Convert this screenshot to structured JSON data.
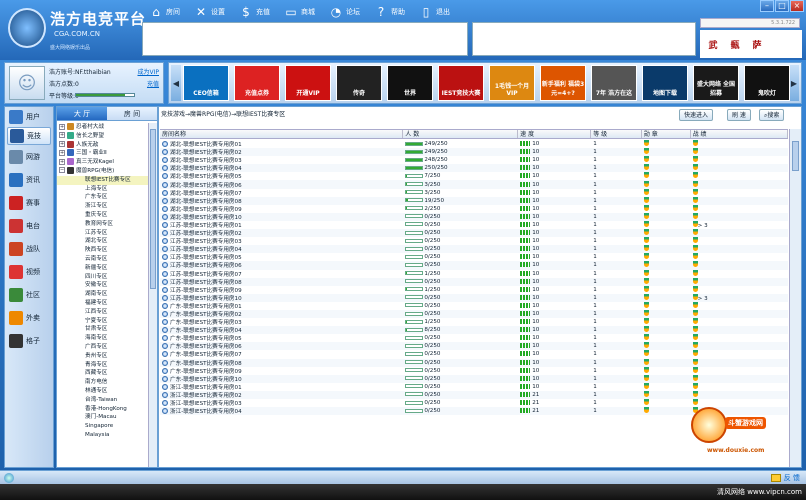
{
  "app": {
    "logo_title": "浩方电竞平台",
    "logo_url": "CGA.COM.CN",
    "logo_slogan": "盛大网络娱乐出品",
    "version": "5.3.1.722"
  },
  "topnav": [
    {
      "icon": "house-icon",
      "label": "房间"
    },
    {
      "icon": "wrench-icon",
      "label": "设置"
    },
    {
      "icon": "dollar-icon",
      "label": "充值"
    },
    {
      "icon": "folder-icon",
      "label": "商城"
    },
    {
      "icon": "chat-icon",
      "label": "论坛"
    },
    {
      "icon": "question-icon",
      "label": "帮助"
    },
    {
      "icon": "exit-icon",
      "label": "退出"
    }
  ],
  "side_icons": [
    "武",
    "甀",
    "萨"
  ],
  "user": {
    "account_label": "浩方账号:",
    "account": "NF.tthaibian",
    "points_label": "浩方点数:",
    "points": "0",
    "level_label": "平台等级:",
    "level": "0",
    "vip_link": "成为VIP",
    "recharge_link": "充值",
    "level_fill": 0.85
  },
  "promos": [
    "CEO信箱",
    "充值点券",
    "开通VIP",
    "传奇",
    "世界",
    "IEST竞技大赛",
    "1毛钱一个月VIP",
    "新手福利 福袋3元=4+?",
    "7年 浩方在这",
    "地图下载",
    "盛大网络 全国招募",
    "鬼吹灯"
  ],
  "leftnav": [
    "用户",
    "竞技",
    "网游",
    "资讯",
    "赛事",
    "电台",
    "战队",
    "视频",
    "社区",
    "外卖",
    "格子"
  ],
  "tree": {
    "tabs": [
      "大 厅",
      "房 间"
    ],
    "games": [
      {
        "label": "忍者村大战",
        "exp": "+"
      },
      {
        "label": "信长之野望",
        "exp": "+"
      },
      {
        "label": "人族无敌",
        "exp": "+"
      },
      {
        "label": "三国・霸业Ⅱ",
        "exp": "+"
      },
      {
        "label": "真三无双Kagel",
        "exp": "+"
      },
      {
        "label": "魔兽RPG(电信)",
        "exp": "−"
      }
    ],
    "leaves": [
      "联想IEST比赛专区",
      "上海专区",
      "广东专区",
      "浙江专区",
      "重庆专区",
      "教育网专区",
      "江苏专区",
      "湖北专区",
      "陕西专区",
      "云南专区",
      "新疆专区",
      "四川专区",
      "安徽专区",
      "湖南专区",
      "福建专区",
      "江西专区",
      "宁夏专区",
      "甘肃专区",
      "海南专区",
      "广西专区",
      "贵州专区",
      "青海专区",
      "西藏专区",
      "南方电信",
      "林通专区",
      "台湾-Taiwan",
      "香港-HongKong",
      "澳门-Macau",
      "Singapore",
      "Malaysia"
    ]
  },
  "main": {
    "breadcrumb": "竞技游戏→魔兽RPG(电信)→联想IEST比赛专区",
    "buttons": [
      "快速进入",
      "刷 速",
      "搜索"
    ],
    "columns": [
      "房间名称",
      "人 数",
      "速 度",
      "等 级",
      "勋 章",
      "战 绩"
    ],
    "rows": [
      {
        "name": "湖北-联想IEST比赛专用房01",
        "count": "249/250",
        "fill": 1.0,
        "speed": "10",
        "level": "1",
        "rec": ""
      },
      {
        "name": "湖北-联想IEST比赛专用房02",
        "count": "249/250",
        "fill": 1.0,
        "speed": "10",
        "level": "1",
        "rec": ""
      },
      {
        "name": "湖北-联想IEST比赛专用房03",
        "count": "248/250",
        "fill": 0.99,
        "speed": "10",
        "level": "1",
        "rec": ""
      },
      {
        "name": "湖北-联想IEST比赛专用房04",
        "count": "250/250",
        "fill": 1.0,
        "speed": "10",
        "level": "1",
        "rec": ""
      },
      {
        "name": "湖北-联想IEST比赛专用房05",
        "count": "7/250",
        "fill": 0.03,
        "speed": "10",
        "level": "1",
        "rec": ""
      },
      {
        "name": "湖北-联想IEST比赛专用房06",
        "count": "3/250",
        "fill": 0.01,
        "speed": "10",
        "level": "1",
        "rec": ""
      },
      {
        "name": "湖北-联想IEST比赛专用房07",
        "count": "3/250",
        "fill": 0.01,
        "speed": "10",
        "level": "1",
        "rec": ""
      },
      {
        "name": "湖北-联想IEST比赛专用房08",
        "count": "19/250",
        "fill": 0.08,
        "speed": "10",
        "level": "1",
        "rec": ""
      },
      {
        "name": "湖北-联想IEST比赛专用房09",
        "count": "2/250",
        "fill": 0.01,
        "speed": "10",
        "level": "1",
        "rec": ""
      },
      {
        "name": "湖北-联想IEST比赛专用房10",
        "count": "0/250",
        "fill": 0,
        "speed": "10",
        "level": "1",
        "rec": ""
      },
      {
        "name": "江苏-联想IEST比赛专用房01",
        "count": "0/250",
        "fill": 0,
        "speed": "10",
        "level": "1",
        "rec": "> 3"
      },
      {
        "name": "江苏-联想IEST比赛专用房02",
        "count": "0/250",
        "fill": 0,
        "speed": "10",
        "level": "1",
        "rec": ""
      },
      {
        "name": "江苏-联想IEST比赛专用房03",
        "count": "0/250",
        "fill": 0,
        "speed": "10",
        "level": "1",
        "rec": ""
      },
      {
        "name": "江苏-联想IEST比赛专用房04",
        "count": "0/250",
        "fill": 0,
        "speed": "10",
        "level": "1",
        "rec": ""
      },
      {
        "name": "江苏-联想IEST比赛专用房05",
        "count": "0/250",
        "fill": 0,
        "speed": "10",
        "level": "1",
        "rec": ""
      },
      {
        "name": "江苏-联想IEST比赛专用房06",
        "count": "0/250",
        "fill": 0,
        "speed": "10",
        "level": "1",
        "rec": ""
      },
      {
        "name": "江苏-联想IEST比赛专用房07",
        "count": "1/250",
        "fill": 0.01,
        "speed": "10",
        "level": "1",
        "rec": ""
      },
      {
        "name": "江苏-联想IEST比赛专用房08",
        "count": "0/250",
        "fill": 0,
        "speed": "10",
        "level": "1",
        "rec": ""
      },
      {
        "name": "江苏-联想IEST比赛专用房09",
        "count": "1/250",
        "fill": 0.01,
        "speed": "10",
        "level": "1",
        "rec": ""
      },
      {
        "name": "江苏-联想IEST比赛专用房10",
        "count": "0/250",
        "fill": 0,
        "speed": "10",
        "level": "1",
        "rec": "> 3"
      },
      {
        "name": "广东-联想IEST比赛专用房01",
        "count": "0/250",
        "fill": 0,
        "speed": "10",
        "level": "1",
        "rec": ""
      },
      {
        "name": "广东-联想IEST比赛专用房02",
        "count": "0/250",
        "fill": 0,
        "speed": "10",
        "level": "1",
        "rec": ""
      },
      {
        "name": "广东-联想IEST比赛专用房03",
        "count": "1/250",
        "fill": 0.01,
        "speed": "10",
        "level": "1",
        "rec": ""
      },
      {
        "name": "广东-联想IEST比赛专用房04",
        "count": "8/250",
        "fill": 0.03,
        "speed": "10",
        "level": "1",
        "rec": ""
      },
      {
        "name": "广东-联想IEST比赛专用房05",
        "count": "0/250",
        "fill": 0,
        "speed": "10",
        "level": "1",
        "rec": ""
      },
      {
        "name": "广东-联想IEST比赛专用房06",
        "count": "0/250",
        "fill": 0,
        "speed": "10",
        "level": "1",
        "rec": ""
      },
      {
        "name": "广东-联想IEST比赛专用房07",
        "count": "0/250",
        "fill": 0,
        "speed": "10",
        "level": "1",
        "rec": ""
      },
      {
        "name": "广东-联想IEST比赛专用房08",
        "count": "0/250",
        "fill": 0,
        "speed": "10",
        "level": "1",
        "rec": ""
      },
      {
        "name": "广东-联想IEST比赛专用房09",
        "count": "0/250",
        "fill": 0,
        "speed": "10",
        "level": "1",
        "rec": ""
      },
      {
        "name": "广东-联想IEST比赛专用房10",
        "count": "0/250",
        "fill": 0,
        "speed": "10",
        "level": "1",
        "rec": ""
      },
      {
        "name": "浙江-联想IEST比赛专用房01",
        "count": "0/250",
        "fill": 0,
        "speed": "10",
        "level": "1",
        "rec": ""
      },
      {
        "name": "浙江-联想IEST比赛专用房02",
        "count": "0/250",
        "fill": 0,
        "speed": "21",
        "level": "1",
        "rec": ""
      },
      {
        "name": "浙江-联想IEST比赛专用房03",
        "count": "0/250",
        "fill": 0,
        "speed": "21",
        "level": "1",
        "rec": ""
      },
      {
        "name": "浙江-联想IEST比赛专用房04",
        "count": "0/250",
        "fill": 0,
        "speed": "21",
        "level": "1",
        "rec": ""
      }
    ]
  },
  "watermark": {
    "text": "斗蟹游戏网",
    "url": "www.douxie.com"
  },
  "status": {
    "feedback": "反 馈"
  },
  "taskbar": {
    "text": "清风网络 www.vipcn.com"
  },
  "colors": {
    "accent": "#2468b8",
    "panel": "#c4dcf4",
    "progress": "#33aa33"
  }
}
